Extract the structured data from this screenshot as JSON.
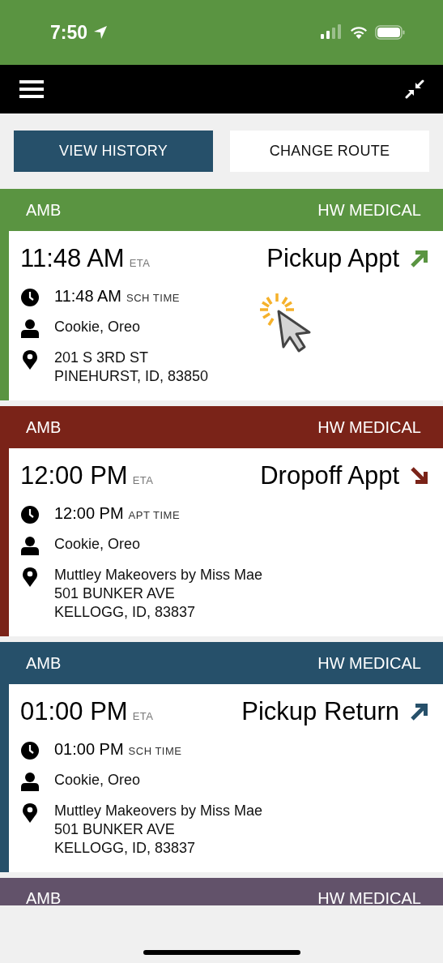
{
  "status_bar": {
    "time": "7:50"
  },
  "buttons": [
    {
      "label": "VIEW HISTORY",
      "kind": "primary"
    },
    {
      "label": "CHANGE ROUTE",
      "kind": "secondary"
    }
  ],
  "trips": [
    {
      "type": "AMB",
      "provider": "HW MEDICAL",
      "color": "#5a9441",
      "eta": "11:48 AM",
      "eta_label": "ETA",
      "stop": "Pickup Appt",
      "kind": "up",
      "time": "11:48 AM",
      "time_label": "SCH TIME",
      "passenger": "Cookie, Oreo",
      "address": [
        "201 S 3RD ST",
        "PINEHURST, ID, 83850"
      ]
    },
    {
      "type": "AMB",
      "provider": "HW MEDICAL",
      "color": "#7a2318",
      "eta": "12:00 PM",
      "eta_label": "ETA",
      "stop": "Dropoff Appt",
      "kind": "down",
      "time": "12:00 PM",
      "time_label": "APT TIME",
      "passenger": "Cookie, Oreo",
      "address": [
        "Muttley Makeovers by Miss Mae",
        "501 BUNKER AVE",
        "KELLOGG, ID, 83837"
      ]
    },
    {
      "type": "AMB",
      "provider": "HW MEDICAL",
      "color": "#26506a",
      "eta": "01:00 PM",
      "eta_label": "ETA",
      "stop": "Pickup Return",
      "kind": "up",
      "time": "01:00 PM",
      "time_label": "SCH TIME",
      "passenger": "Cookie, Oreo",
      "address": [
        "Muttley Makeovers by Miss Mae",
        "501 BUNKER AVE",
        "KELLOGG, ID, 83837"
      ]
    },
    {
      "type": "AMB",
      "provider": "HW MEDICAL",
      "color": "#62526a"
    }
  ]
}
